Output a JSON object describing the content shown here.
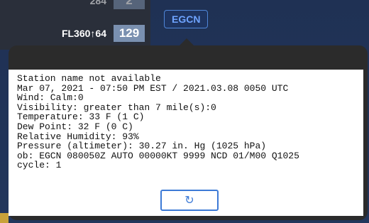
{
  "background": {
    "flights": [
      {
        "label": "284",
        "count": "2"
      },
      {
        "label": "FL360↑64",
        "count": "129"
      }
    ],
    "station_tag": "EGCN"
  },
  "report": {
    "lines": [
      "Station name not available",
      "Mar 07, 2021 - 07:50 PM EST / 2021.03.08 0050 UTC",
      "Wind: Calm:0",
      "Visibility: greater than 7 mile(s):0",
      "Temperature: 33 F (1 C)",
      "Dew Point: 32 F (0 C)",
      "Relative Humidity: 93%",
      "Pressure (altimeter): 30.27 in. Hg (1025 hPa)",
      "ob: EGCN 080050Z AUTO 00000KT 9999 NCD 01/M00 Q1025",
      "cycle: 1"
    ]
  },
  "refresh_button": {
    "icon": "refresh-icon",
    "glyph": "↻"
  },
  "colors": {
    "accent": "#3d7ad6",
    "popup_frame": "#2b2b2b"
  }
}
